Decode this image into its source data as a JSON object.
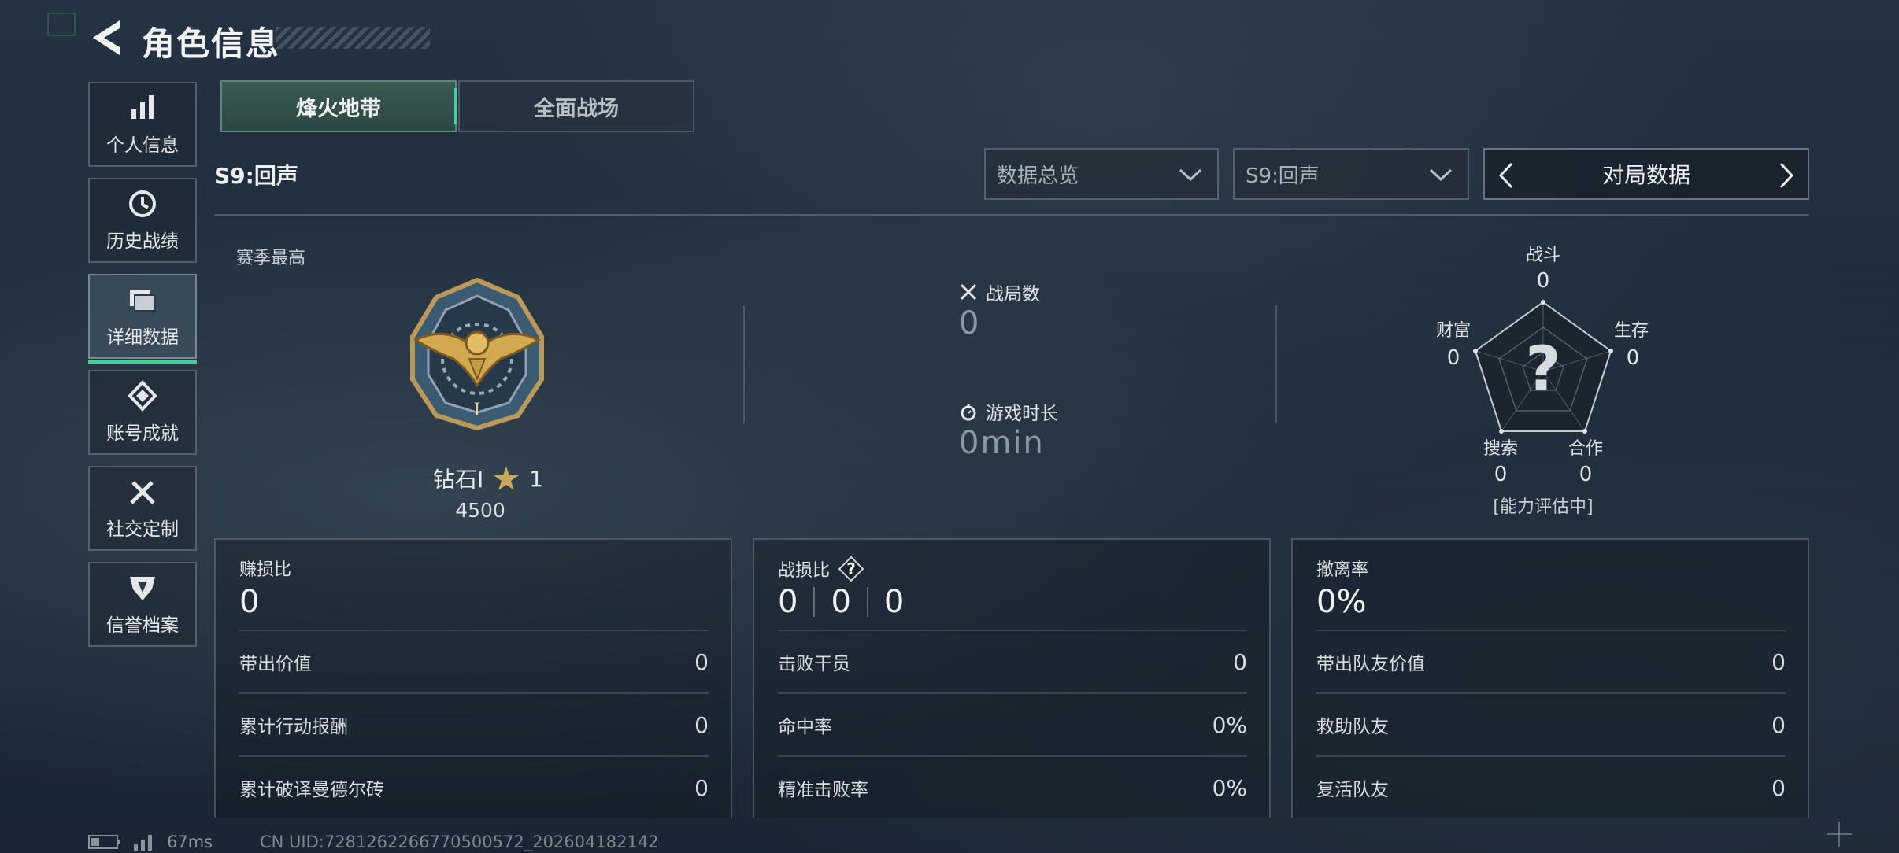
{
  "header": {
    "title": "角色信息"
  },
  "sidebar": {
    "items": [
      {
        "label": "个人信息",
        "icon": "bar-chart-icon",
        "active": false
      },
      {
        "label": "历史战绩",
        "icon": "clock-icon",
        "active": false
      },
      {
        "label": "详细数据",
        "icon": "folder-icon",
        "active": true
      },
      {
        "label": "账号成就",
        "icon": "achievement-icon",
        "active": false
      },
      {
        "label": "社交定制",
        "icon": "tools-icon",
        "active": false
      },
      {
        "label": "信誉档案",
        "icon": "shield-icon",
        "active": false
      }
    ]
  },
  "tabs": [
    {
      "label": "烽火地带",
      "active": true
    },
    {
      "label": "全面战场",
      "active": false
    }
  ],
  "season_label": "S9:回声",
  "filters": {
    "overview": "数据总览",
    "season": "S9:回声",
    "pager": "对局数据"
  },
  "rank": {
    "season_best_label": "赛季最高",
    "name": "钻石I",
    "stars": "1",
    "score": "4500"
  },
  "battle_stats": {
    "matches_label": "战局数",
    "matches_value": "0",
    "playtime_label": "游戏时长",
    "playtime_value": "0min"
  },
  "radar": {
    "combat": {
      "label": "战斗",
      "value": "0"
    },
    "survival": {
      "label": "生存",
      "value": "0"
    },
    "cooperation": {
      "label": "合作",
      "value": "0"
    },
    "search": {
      "label": "搜索",
      "value": "0"
    },
    "wealth": {
      "label": "财富",
      "value": "0"
    },
    "center_mark": "?",
    "note": "[能力评估中]"
  },
  "panels": {
    "profit": {
      "title": "赚损比",
      "value": "0",
      "rows": [
        {
          "label": "带出价值",
          "value": "0"
        },
        {
          "label": "累计行动报酬",
          "value": "0"
        },
        {
          "label": "累计破译曼德尔砖",
          "value": "0"
        }
      ]
    },
    "kd": {
      "title": "战损比",
      "help": "?",
      "values": [
        "0",
        "0",
        "0"
      ],
      "rows": [
        {
          "label": "击败干员",
          "value": "0"
        },
        {
          "label": "命中率",
          "value": "0%"
        },
        {
          "label": "精准击败率",
          "value": "0%"
        }
      ]
    },
    "extract": {
      "title": "撤离率",
      "value": "0%",
      "rows": [
        {
          "label": "带出队友价值",
          "value": "0"
        },
        {
          "label": "救助队友",
          "value": "0"
        },
        {
          "label": "复活队友",
          "value": "0"
        }
      ]
    }
  },
  "footer": {
    "ping": "67ms",
    "uid": "CN UID:7281262266770500572_202604182142"
  },
  "colors": {
    "accent": "#3fd39a",
    "background": "#1f2c3a"
  }
}
